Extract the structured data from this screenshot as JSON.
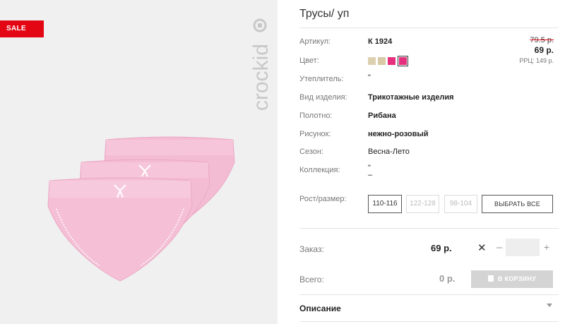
{
  "badge": {
    "sale": "SALE"
  },
  "brand": {
    "logo_text": "crockid"
  },
  "product": {
    "title": "Трусы/ уп",
    "attributes": [
      {
        "label": "Артикул:",
        "value": "К 1924"
      },
      {
        "label": "Цвет:",
        "value": ""
      },
      {
        "label": "Утеплитель:",
        "value": "\""
      },
      {
        "label": "Вид изделия:",
        "value": "Трикотажные изделия"
      },
      {
        "label": "Полотно:",
        "value": "Рибана"
      },
      {
        "label": "Рисунок:",
        "value": "нежно-розовый"
      },
      {
        "label": "Сезон:",
        "value": "Весна-Лето"
      },
      {
        "label": "Коллекция:",
        "value": "\"",
        "value2": "–"
      }
    ],
    "colors": [
      "#ddd0b0",
      "#d8caa6",
      "#e6307d",
      "#e6307d"
    ],
    "selected_color_index": 3
  },
  "price": {
    "old": "79.5 р.",
    "new": "69 р.",
    "rrp": "РРЦ: 149 р."
  },
  "sizes": {
    "label": "Рост/размер:",
    "options": [
      "110-116",
      "122-128",
      "98-104"
    ],
    "active_index": 0,
    "select_all": "ВЫБРАТЬ ВСЕ"
  },
  "order": {
    "label": "Заказ:",
    "price": "69 р.",
    "times": "✕",
    "minus": "–",
    "quantity": "",
    "plus": "+"
  },
  "total": {
    "label": "Всего:",
    "value": "0 р.",
    "cart_button": "В КОРЗИНУ"
  },
  "description": {
    "title": "Описание"
  },
  "colors_theme": {
    "accent": "#e30613",
    "swatch_pink": "#e6307d",
    "panties_pink": "#f4bcd3"
  }
}
